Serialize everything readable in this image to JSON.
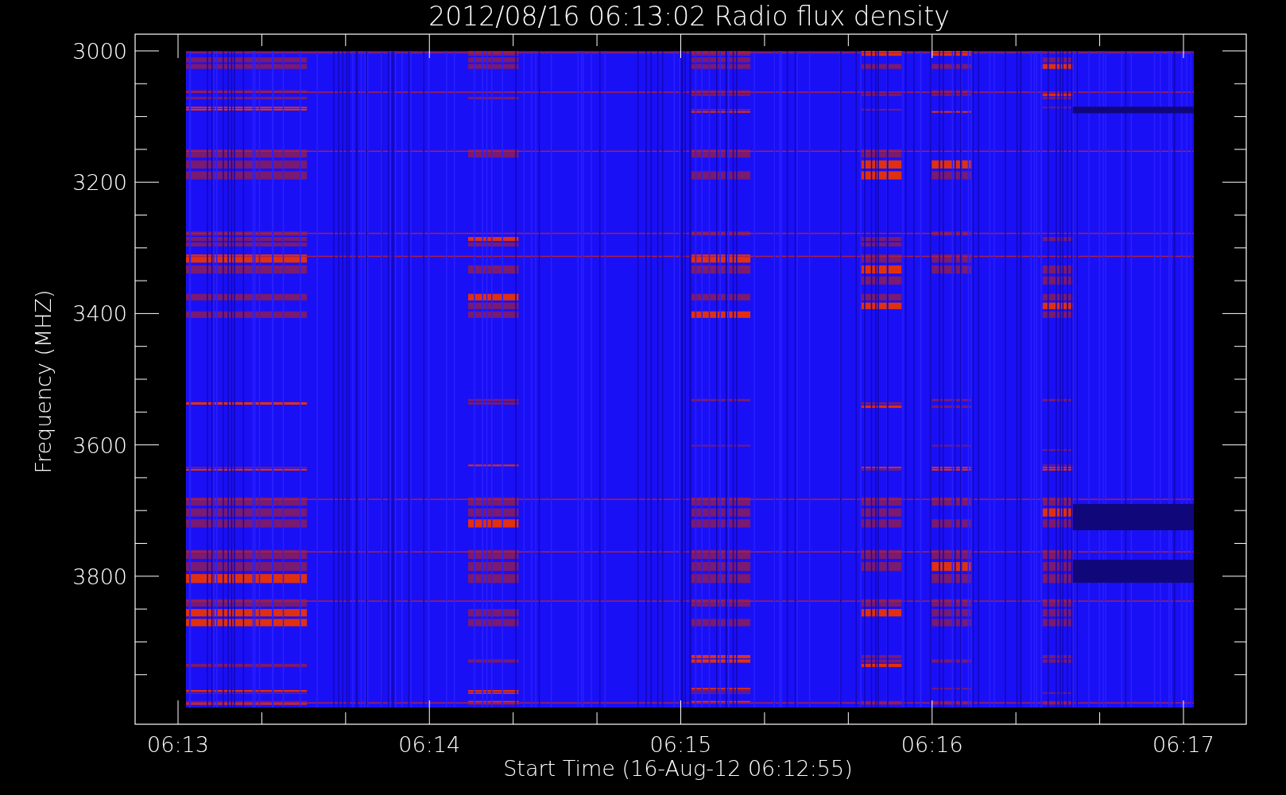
{
  "plot": {
    "title": "2012/08/16 06:13:02 Radio flux density",
    "ylabel": "Frequency (MHZ)",
    "xlabel": "Start Time (16-Aug-12 06:12:55)",
    "y_tick_labels": [
      "3000",
      "3200",
      "3400",
      "3600",
      "3800"
    ],
    "x_tick_labels": [
      "06:13",
      "06:14",
      "06:15",
      "06:16",
      "06:17"
    ]
  }
}
